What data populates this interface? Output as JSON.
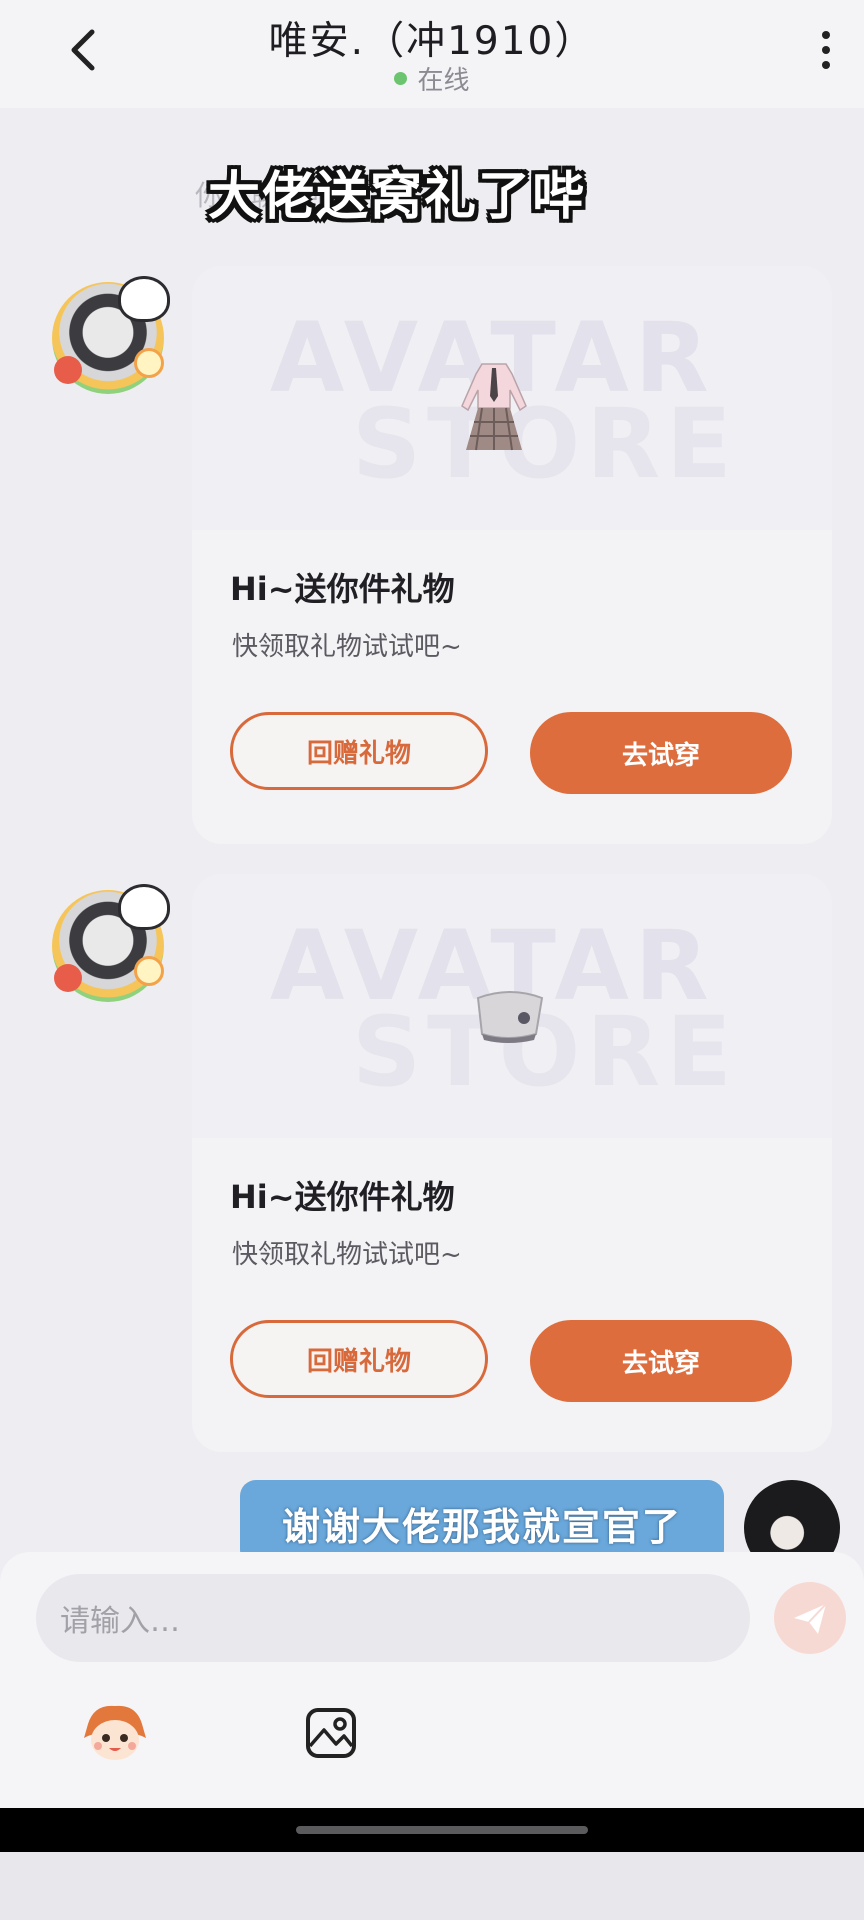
{
  "header": {
    "title": "唯安.（冲1910）",
    "status": "在线"
  },
  "hint": "你…聊天吧",
  "caption": "大佬送窝礼了哔",
  "gift_cards": [
    {
      "title": "Hi~送你件礼物",
      "subtitle": "快领取礼物试试吧~",
      "return_label": "回赠礼物",
      "try_label": "去试穿",
      "watermark_top": "AVATAR",
      "watermark_bottom": "STORE"
    },
    {
      "title": "Hi~送你件礼物",
      "subtitle": "快领取礼物试试吧~",
      "return_label": "回赠礼物",
      "try_label": "去试穿",
      "watermark_top": "AVATAR",
      "watermark_bottom": "STORE"
    }
  ],
  "my_message": "谢谢大佬那我就宣官了",
  "composer": {
    "placeholder": "请输入…"
  },
  "colors": {
    "accent": "#de6d3d",
    "my_bubble": "#6aa8db",
    "online": "#6cc46f"
  },
  "icons": [
    "back-icon",
    "more-icon",
    "gift-dress-icon",
    "gift-hat-icon",
    "send-icon",
    "emoji-face-icon",
    "image-icon"
  ]
}
